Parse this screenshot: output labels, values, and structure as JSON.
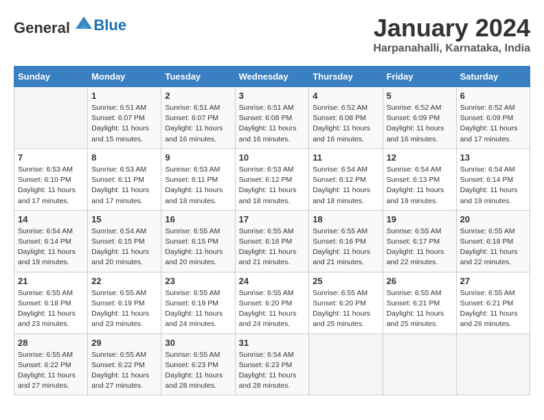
{
  "header": {
    "logo_general": "General",
    "logo_blue": "Blue",
    "month_title": "January 2024",
    "location": "Harpanahalli, Karnataka, India"
  },
  "days_of_week": [
    "Sunday",
    "Monday",
    "Tuesday",
    "Wednesday",
    "Thursday",
    "Friday",
    "Saturday"
  ],
  "weeks": [
    [
      {
        "day": "",
        "sunrise": "",
        "sunset": "",
        "daylight": ""
      },
      {
        "day": "1",
        "sunrise": "Sunrise: 6:51 AM",
        "sunset": "Sunset: 6:07 PM",
        "daylight": "Daylight: 11 hours and 15 minutes."
      },
      {
        "day": "2",
        "sunrise": "Sunrise: 6:51 AM",
        "sunset": "Sunset: 6:07 PM",
        "daylight": "Daylight: 11 hours and 16 minutes."
      },
      {
        "day": "3",
        "sunrise": "Sunrise: 6:51 AM",
        "sunset": "Sunset: 6:08 PM",
        "daylight": "Daylight: 11 hours and 16 minutes."
      },
      {
        "day": "4",
        "sunrise": "Sunrise: 6:52 AM",
        "sunset": "Sunset: 6:08 PM",
        "daylight": "Daylight: 11 hours and 16 minutes."
      },
      {
        "day": "5",
        "sunrise": "Sunrise: 6:52 AM",
        "sunset": "Sunset: 6:09 PM",
        "daylight": "Daylight: 11 hours and 16 minutes."
      },
      {
        "day": "6",
        "sunrise": "Sunrise: 6:52 AM",
        "sunset": "Sunset: 6:09 PM",
        "daylight": "Daylight: 11 hours and 17 minutes."
      }
    ],
    [
      {
        "day": "7",
        "sunrise": "Sunrise: 6:53 AM",
        "sunset": "Sunset: 6:10 PM",
        "daylight": "Daylight: 11 hours and 17 minutes."
      },
      {
        "day": "8",
        "sunrise": "Sunrise: 6:53 AM",
        "sunset": "Sunset: 6:11 PM",
        "daylight": "Daylight: 11 hours and 17 minutes."
      },
      {
        "day": "9",
        "sunrise": "Sunrise: 6:53 AM",
        "sunset": "Sunset: 6:11 PM",
        "daylight": "Daylight: 11 hours and 18 minutes."
      },
      {
        "day": "10",
        "sunrise": "Sunrise: 6:53 AM",
        "sunset": "Sunset: 6:12 PM",
        "daylight": "Daylight: 11 hours and 18 minutes."
      },
      {
        "day": "11",
        "sunrise": "Sunrise: 6:54 AM",
        "sunset": "Sunset: 6:12 PM",
        "daylight": "Daylight: 11 hours and 18 minutes."
      },
      {
        "day": "12",
        "sunrise": "Sunrise: 6:54 AM",
        "sunset": "Sunset: 6:13 PM",
        "daylight": "Daylight: 11 hours and 19 minutes."
      },
      {
        "day": "13",
        "sunrise": "Sunrise: 6:54 AM",
        "sunset": "Sunset: 6:14 PM",
        "daylight": "Daylight: 11 hours and 19 minutes."
      }
    ],
    [
      {
        "day": "14",
        "sunrise": "Sunrise: 6:54 AM",
        "sunset": "Sunset: 6:14 PM",
        "daylight": "Daylight: 11 hours and 19 minutes."
      },
      {
        "day": "15",
        "sunrise": "Sunrise: 6:54 AM",
        "sunset": "Sunset: 6:15 PM",
        "daylight": "Daylight: 11 hours and 20 minutes."
      },
      {
        "day": "16",
        "sunrise": "Sunrise: 6:55 AM",
        "sunset": "Sunset: 6:15 PM",
        "daylight": "Daylight: 11 hours and 20 minutes."
      },
      {
        "day": "17",
        "sunrise": "Sunrise: 6:55 AM",
        "sunset": "Sunset: 6:16 PM",
        "daylight": "Daylight: 11 hours and 21 minutes."
      },
      {
        "day": "18",
        "sunrise": "Sunrise: 6:55 AM",
        "sunset": "Sunset: 6:16 PM",
        "daylight": "Daylight: 11 hours and 21 minutes."
      },
      {
        "day": "19",
        "sunrise": "Sunrise: 6:55 AM",
        "sunset": "Sunset: 6:17 PM",
        "daylight": "Daylight: 11 hours and 22 minutes."
      },
      {
        "day": "20",
        "sunrise": "Sunrise: 6:55 AM",
        "sunset": "Sunset: 6:18 PM",
        "daylight": "Daylight: 11 hours and 22 minutes."
      }
    ],
    [
      {
        "day": "21",
        "sunrise": "Sunrise: 6:55 AM",
        "sunset": "Sunset: 6:18 PM",
        "daylight": "Daylight: 11 hours and 23 minutes."
      },
      {
        "day": "22",
        "sunrise": "Sunrise: 6:55 AM",
        "sunset": "Sunset: 6:19 PM",
        "daylight": "Daylight: 11 hours and 23 minutes."
      },
      {
        "day": "23",
        "sunrise": "Sunrise: 6:55 AM",
        "sunset": "Sunset: 6:19 PM",
        "daylight": "Daylight: 11 hours and 24 minutes."
      },
      {
        "day": "24",
        "sunrise": "Sunrise: 6:55 AM",
        "sunset": "Sunset: 6:20 PM",
        "daylight": "Daylight: 11 hours and 24 minutes."
      },
      {
        "day": "25",
        "sunrise": "Sunrise: 6:55 AM",
        "sunset": "Sunset: 6:20 PM",
        "daylight": "Daylight: 11 hours and 25 minutes."
      },
      {
        "day": "26",
        "sunrise": "Sunrise: 6:55 AM",
        "sunset": "Sunset: 6:21 PM",
        "daylight": "Daylight: 11 hours and 25 minutes."
      },
      {
        "day": "27",
        "sunrise": "Sunrise: 6:55 AM",
        "sunset": "Sunset: 6:21 PM",
        "daylight": "Daylight: 11 hours and 26 minutes."
      }
    ],
    [
      {
        "day": "28",
        "sunrise": "Sunrise: 6:55 AM",
        "sunset": "Sunset: 6:22 PM",
        "daylight": "Daylight: 11 hours and 27 minutes."
      },
      {
        "day": "29",
        "sunrise": "Sunrise: 6:55 AM",
        "sunset": "Sunset: 6:22 PM",
        "daylight": "Daylight: 11 hours and 27 minutes."
      },
      {
        "day": "30",
        "sunrise": "Sunrise: 6:55 AM",
        "sunset": "Sunset: 6:23 PM",
        "daylight": "Daylight: 11 hours and 28 minutes."
      },
      {
        "day": "31",
        "sunrise": "Sunrise: 6:54 AM",
        "sunset": "Sunset: 6:23 PM",
        "daylight": "Daylight: 11 hours and 28 minutes."
      },
      {
        "day": "",
        "sunrise": "",
        "sunset": "",
        "daylight": ""
      },
      {
        "day": "",
        "sunrise": "",
        "sunset": "",
        "daylight": ""
      },
      {
        "day": "",
        "sunrise": "",
        "sunset": "",
        "daylight": ""
      }
    ]
  ]
}
